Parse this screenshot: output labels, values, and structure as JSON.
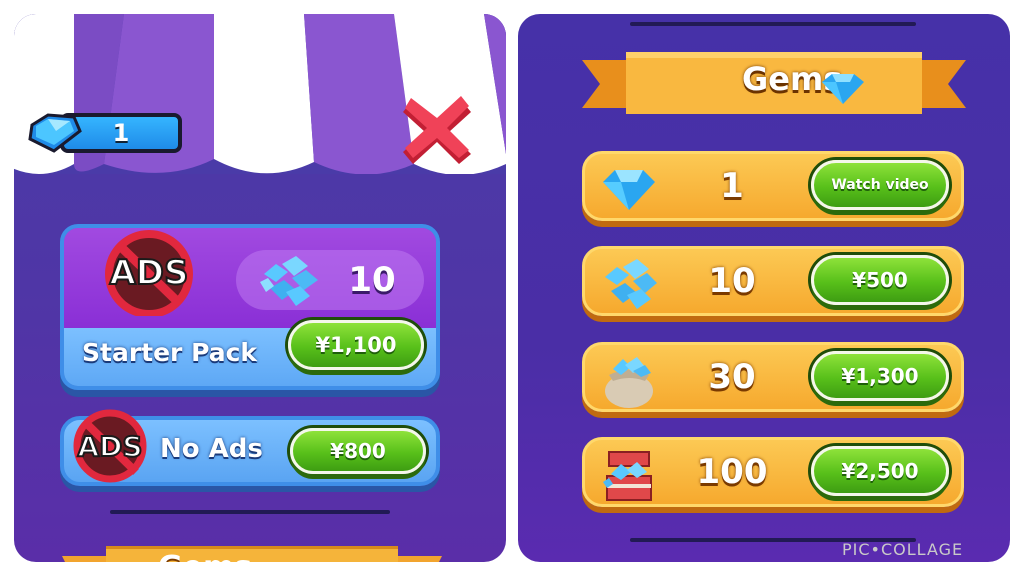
{
  "left": {
    "gem_count": "1",
    "starter_pack": {
      "ads_text": "ADS",
      "gem_amount": "10",
      "label": "Starter Pack",
      "price": "¥1,100"
    },
    "no_ads": {
      "ads_text": "ADS",
      "label": "No Ads",
      "price": "¥800"
    },
    "bottom_banner_title": "Gems"
  },
  "right": {
    "title": "Gems",
    "offers": [
      {
        "amount": "1",
        "button": "Watch video",
        "icon": "gem-icon"
      },
      {
        "amount": "10",
        "button": "¥500",
        "icon": "gem-pile-icon"
      },
      {
        "amount": "30",
        "button": "¥1,300",
        "icon": "gem-sack-icon"
      },
      {
        "amount": "100",
        "button": "¥2,500",
        "icon": "treasure-chest-icon"
      }
    ]
  },
  "watermark": "PIC•COLLAGE",
  "colors": {
    "panel_bg": "#4b36a8",
    "green_button": "#58c01a",
    "orange_row": "#f6a92e",
    "blue_card": "#5ea8f5",
    "purple_card": "#8a2fd6",
    "gem_blue": "#35b5ff"
  }
}
